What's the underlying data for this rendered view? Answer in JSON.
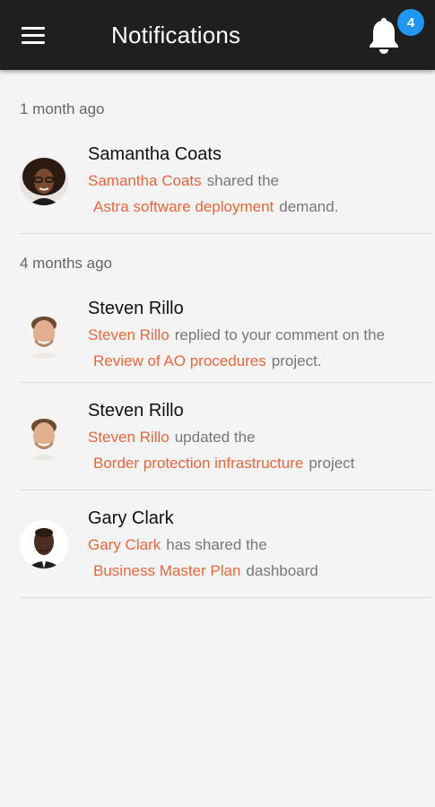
{
  "header": {
    "title": "Notifications",
    "badge_count": "4",
    "menu_icon": "hamburger-menu-icon",
    "bell_icon": "bell-icon"
  },
  "colors": {
    "topbar": "#1f1f1f",
    "accent_link": "#e8663d",
    "badge": "#2196f3",
    "background": "#f4f4f4"
  },
  "groups": [
    {
      "header": "1 month ago",
      "items": [
        {
          "name": "Samantha Coats",
          "actor": "Samantha Coats",
          "action": "shared the",
          "target": "Astra software deployment",
          "suffix": "demand."
        }
      ]
    },
    {
      "header": "4 months ago",
      "items": [
        {
          "name": "Steven Rillo",
          "actor": "Steven Rillo",
          "action": "replied to your comment on the",
          "target": "Review of AO procedures",
          "suffix": "project."
        },
        {
          "name": "Steven Rillo",
          "actor": "Steven Rillo",
          "action": "updated the",
          "target": "Border protection infrastructure",
          "suffix": "project"
        },
        {
          "name": "Gary Clark",
          "actor": "Gary Clark",
          "action": "has shared the",
          "target": "Business Master Plan",
          "suffix": "dashboard"
        }
      ]
    }
  ]
}
